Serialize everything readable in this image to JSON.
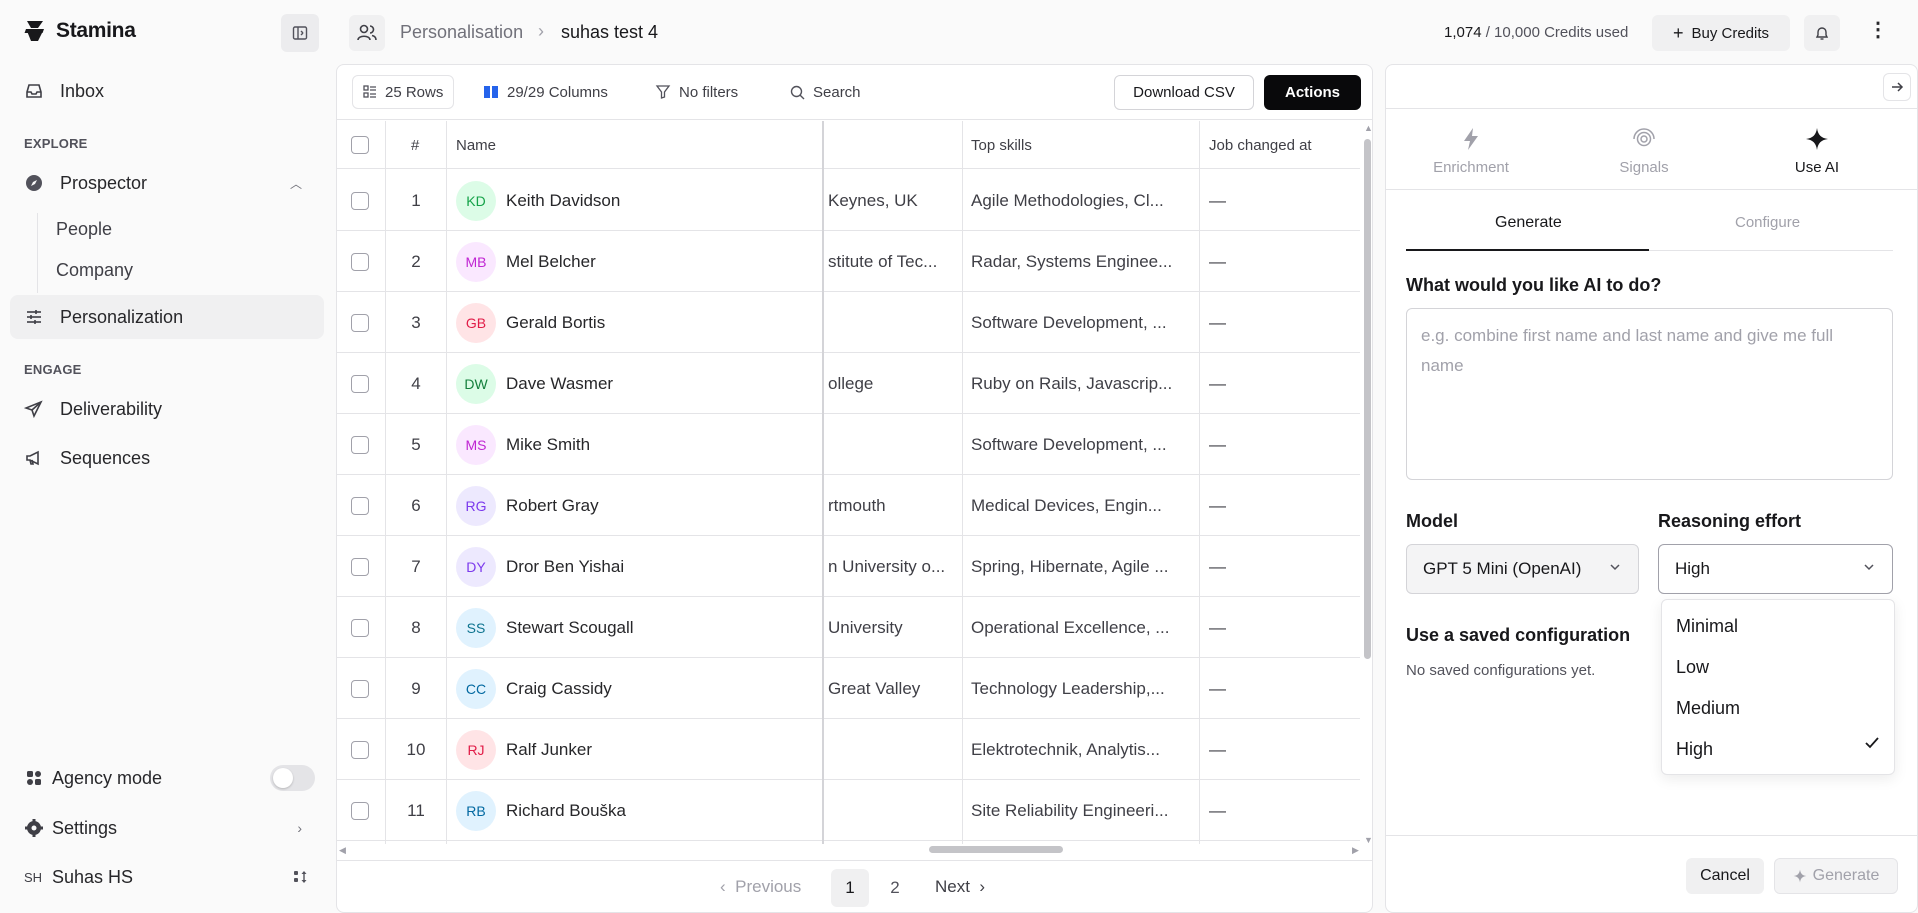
{
  "app": {
    "name": "Stamina"
  },
  "sidebar": {
    "inbox": "Inbox",
    "explore_label": "EXPLORE",
    "prospector": "Prospector",
    "people": "People",
    "company": "Company",
    "personalization": "Personalization",
    "engage_label": "ENGAGE",
    "deliverability": "Deliverability",
    "sequences": "Sequences",
    "agency_mode": "Agency mode",
    "agency_mode_on": false,
    "settings": "Settings",
    "user_initials": "SH",
    "user_name": "Suhas HS"
  },
  "header": {
    "breadcrumb_parent": "Personalisation",
    "breadcrumb_current": "suhas test 4",
    "credits_used": "1,074",
    "credits_total": " / 10,000 Credits used",
    "buy_credits": "Buy Credits"
  },
  "toolbar": {
    "rows": "25 Rows",
    "columns": "29/29 Columns",
    "filters": "No filters",
    "search": "Search",
    "download_csv": "Download CSV",
    "actions": "Actions"
  },
  "table": {
    "headers": {
      "index": "#",
      "name": "Name",
      "top_skills": "Top skills",
      "job_changed_at": "Job changed at"
    },
    "rows": [
      {
        "num": "1",
        "initials": "KD",
        "name": "Keith Davidson",
        "partial": "Keynes, UK",
        "skills": "Agile Methodologies, Cl...",
        "job": "—",
        "color": "#16a34a",
        "bg": "#dcfce7"
      },
      {
        "num": "2",
        "initials": "MB",
        "name": "Mel Belcher",
        "partial": "stitute of Tec...",
        "skills": "Radar, Systems Enginee...",
        "job": "—",
        "color": "#c026d3",
        "bg": "#fae8ff"
      },
      {
        "num": "3",
        "initials": "GB",
        "name": "Gerald Bortis",
        "partial": "",
        "skills": "Software Development, ...",
        "job": "—",
        "color": "#e11d48",
        "bg": "#ffe4e6"
      },
      {
        "num": "4",
        "initials": "DW",
        "name": "Dave Wasmer",
        "partial": "ollege",
        "skills": "Ruby on Rails, Javascrip...",
        "job": "—",
        "color": "#15803d",
        "bg": "#dcfce7"
      },
      {
        "num": "5",
        "initials": "MS",
        "name": "Mike Smith",
        "partial": "",
        "skills": "Software Development, ...",
        "job": "—",
        "color": "#c026d3",
        "bg": "#fae8ff"
      },
      {
        "num": "6",
        "initials": "RG",
        "name": "Robert Gray",
        "partial": "rtmouth",
        "skills": "Medical Devices, Engin...",
        "job": "—",
        "color": "#7c3aed",
        "bg": "#ede9fe"
      },
      {
        "num": "7",
        "initials": "DY",
        "name": "Dror Ben Yishai",
        "partial": "n University o...",
        "skills": "Spring, Hibernate, Agile ...",
        "job": "—",
        "color": "#7c3aed",
        "bg": "#ede9fe"
      },
      {
        "num": "8",
        "initials": "SS",
        "name": "Stewart Scougall",
        "partial": "University",
        "skills": "Operational Excellence, ...",
        "job": "—",
        "color": "#0e7490",
        "bg": "#e0f2fe"
      },
      {
        "num": "9",
        "initials": "CC",
        "name": "Craig Cassidy",
        "partial": "Great Valley",
        "skills": "Technology Leadership,...",
        "job": "—",
        "color": "#0369a1",
        "bg": "#e0f2fe"
      },
      {
        "num": "10",
        "initials": "RJ",
        "name": "Ralf Junker",
        "partial": "",
        "skills": "Elektrotechnik, Analytis...",
        "job": "—",
        "color": "#e11d48",
        "bg": "#ffe4e6"
      },
      {
        "num": "11",
        "initials": "RB",
        "name": "Richard Bouška",
        "partial": "",
        "skills": "Site Reliability Engineeri...",
        "job": "—",
        "color": "#0369a1",
        "bg": "#e0f2fe"
      }
    ]
  },
  "pagination": {
    "previous": "Previous",
    "pages": [
      "1",
      "2"
    ],
    "current": "1",
    "next": "Next"
  },
  "ai_panel": {
    "tabs": [
      "Enrichment",
      "Signals",
      "Use AI"
    ],
    "active_tab": "Use AI",
    "subtabs": [
      "Generate",
      "Configure"
    ],
    "question": "What would you like AI to do?",
    "placeholder": "e.g. combine first name and last name and give me full name",
    "model_label": "Model",
    "model_value": "GPT 5 Mini (OpenAI)",
    "effort_label": "Reasoning effort",
    "effort_value": "High",
    "effort_options": [
      "Minimal",
      "Low",
      "Medium",
      "High"
    ],
    "saved_label": "Use a saved configuration",
    "saved_empty": "No saved configurations yet.",
    "cancel": "Cancel",
    "generate": "Generate"
  }
}
